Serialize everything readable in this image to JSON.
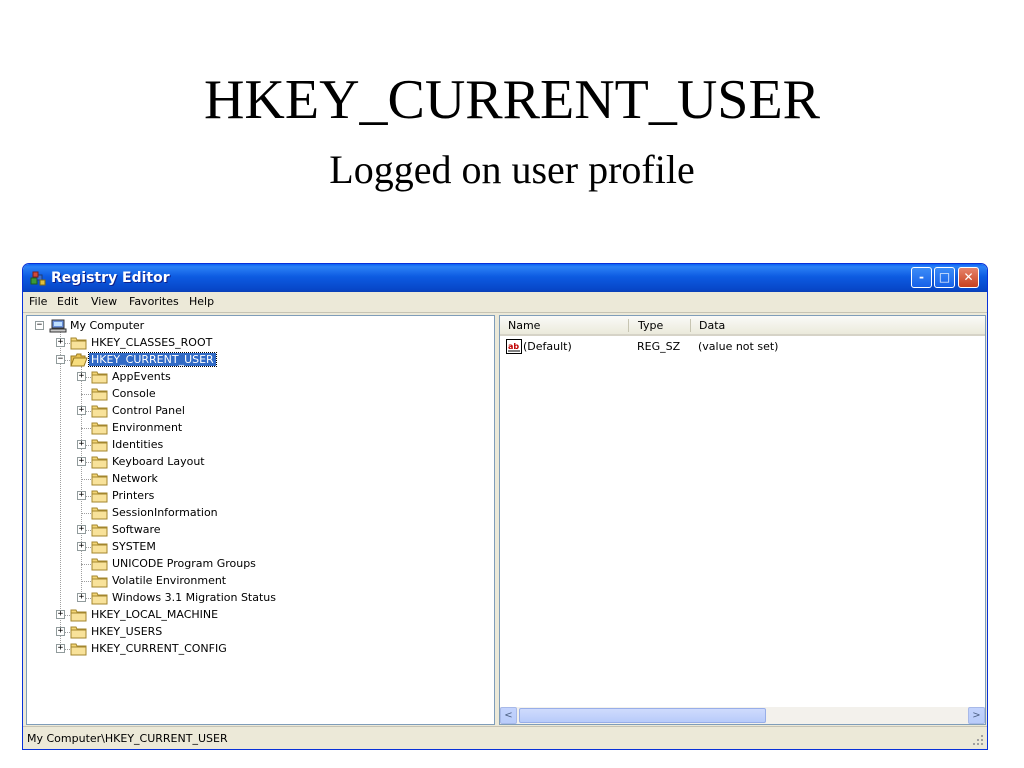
{
  "slide": {
    "title": "HKEY_CURRENT_USER",
    "subtitle": "Logged on user profile"
  },
  "window": {
    "title": "Registry Editor",
    "controls": {
      "minimize": "-",
      "maximize": "□",
      "close": "✕"
    }
  },
  "menu": {
    "items": [
      {
        "label": "File"
      },
      {
        "label": "Edit"
      },
      {
        "label": "View"
      },
      {
        "label": "Favorites"
      },
      {
        "label": "Help"
      }
    ]
  },
  "tree": {
    "root": {
      "label": "My Computer",
      "icon": "computer-icon",
      "expander": "−"
    },
    "hives_top": [
      {
        "label": "HKEY_CLASSES_ROOT",
        "expander": "+"
      }
    ],
    "selected_hive": {
      "label": "HKEY_CURRENT_USER",
      "expander": "−",
      "icon": "open-folder-icon"
    },
    "children": [
      {
        "label": "AppEvents",
        "expander": "+"
      },
      {
        "label": "Console",
        "expander": ""
      },
      {
        "label": "Control Panel",
        "expander": "+"
      },
      {
        "label": "Environment",
        "expander": ""
      },
      {
        "label": "Identities",
        "expander": "+"
      },
      {
        "label": "Keyboard Layout",
        "expander": "+"
      },
      {
        "label": "Network",
        "expander": ""
      },
      {
        "label": "Printers",
        "expander": "+"
      },
      {
        "label": "SessionInformation",
        "expander": ""
      },
      {
        "label": "Software",
        "expander": "+"
      },
      {
        "label": "SYSTEM",
        "expander": "+"
      },
      {
        "label": "UNICODE Program Groups",
        "expander": ""
      },
      {
        "label": "Volatile Environment",
        "expander": ""
      },
      {
        "label": "Windows 3.1 Migration Status",
        "expander": "+"
      }
    ],
    "hives_bottom": [
      {
        "label": "HKEY_LOCAL_MACHINE",
        "expander": "+"
      },
      {
        "label": "HKEY_USERS",
        "expander": "+"
      },
      {
        "label": "HKEY_CURRENT_CONFIG",
        "expander": "+"
      }
    ]
  },
  "list": {
    "columns": {
      "name": "Name",
      "type": "Type",
      "data": "Data"
    },
    "rows": [
      {
        "name": "(Default)",
        "type": "REG_SZ",
        "data": "(value not set)",
        "icon": "string-value-icon"
      }
    ],
    "scroll": {
      "left": "<",
      "right": ">",
      "grip": "|||"
    }
  },
  "status": {
    "path": "My Computer\\HKEY_CURRENT_USER"
  },
  "colors": {
    "titlebar": "#0a55e0",
    "selection": "#316ac5",
    "folder": "#f3d577",
    "chrome": "#ece9d8"
  }
}
